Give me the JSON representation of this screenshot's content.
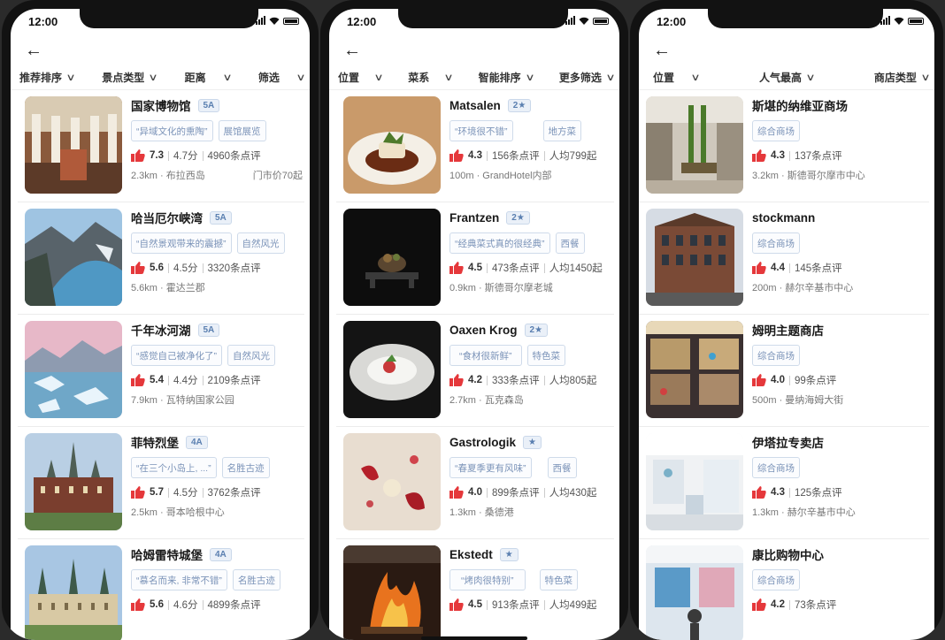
{
  "phones": [
    {
      "time": "12:00",
      "filters": [
        "推荐排序",
        "景点类型",
        "距离",
        "筛选"
      ],
      "items": [
        {
          "title": "国家博物馆",
          "badge": "5A",
          "tags": [
            "“异域文化的熏陶”",
            "展馆展览"
          ],
          "score": "7.3",
          "rating": "4.7分",
          "reviews": "4960条点评",
          "distance": "2.3km · 布拉西岛",
          "extra": "门市价70起"
        },
        {
          "title": "哈当厄尔峡湾",
          "badge": "5A",
          "tags": [
            "“自然景观带来的震撼”",
            "自然风光"
          ],
          "score": "5.6",
          "rating": "4.5分",
          "reviews": "3320条点评",
          "distance": "5.6km · 霍达兰郡",
          "extra": ""
        },
        {
          "title": "千年冰河湖",
          "badge": "5A",
          "tags": [
            "“感觉自己被净化了”",
            "自然风光"
          ],
          "score": "5.4",
          "rating": "4.4分",
          "reviews": "2109条点评",
          "distance": "7.9km · 瓦特纳国家公园",
          "extra": ""
        },
        {
          "title": "菲特烈堡",
          "badge": "4A",
          "tags": [
            "“在三个小岛上, ...”",
            "名胜古迹"
          ],
          "score": "5.7",
          "rating": "4.5分",
          "reviews": "3762条点评",
          "distance": "2.5km · 哥本哈根中心",
          "extra": ""
        },
        {
          "title": "哈姆雷特城堡",
          "badge": "4A",
          "tags": [
            "“慕名而来, 非常不错”",
            "名胜古迹"
          ],
          "score": "5.6",
          "rating": "4.6分",
          "reviews": "4899条点评",
          "distance": "",
          "extra": ""
        }
      ]
    },
    {
      "time": "12:00",
      "filters": [
        "位置",
        "菜系",
        "智能排序",
        "更多筛选"
      ],
      "items": [
        {
          "title": "Matsalen",
          "badge": "2★",
          "tags": [
            "“环境很不错”",
            "地方菜"
          ],
          "score": "4.3",
          "rating": "156条点评",
          "reviews": "人均799起",
          "distance": "100m · GrandHotel内部",
          "extra": ""
        },
        {
          "title": "Frantzen",
          "badge": "2★",
          "tags": [
            "“经典菜式真的很经典”",
            "西餐"
          ],
          "score": "4.5",
          "rating": "473条点评",
          "reviews": "人均1450起",
          "distance": "0.9km · 斯德哥尔摩老城",
          "extra": ""
        },
        {
          "title": "Oaxen Krog",
          "badge": "2★",
          "tags": [
            "“食材很新鲜”",
            "特色菜"
          ],
          "score": "4.2",
          "rating": "333条点评",
          "reviews": "人均805起",
          "distance": "2.7km · 瓦克森岛",
          "extra": ""
        },
        {
          "title": "Gastrologik",
          "badge": "★",
          "tags": [
            "“春夏季更有风味”",
            "西餐"
          ],
          "score": "4.0",
          "rating": "899条点评",
          "reviews": "人均430起",
          "distance": "1.3km · 桑德港",
          "extra": ""
        },
        {
          "title": "Ekstedt",
          "badge": "★",
          "tags": [
            "“烤肉很特别”",
            "特色菜"
          ],
          "score": "4.5",
          "rating": "913条点评",
          "reviews": "人均499起",
          "distance": "",
          "extra": ""
        }
      ]
    },
    {
      "time": "12:00",
      "filters": [
        "位置",
        "人气最高",
        "商店类型"
      ],
      "items": [
        {
          "title": "斯堪的纳维亚商场",
          "badge": "",
          "tags": [
            "综合商场"
          ],
          "score": "4.3",
          "rating": "137条点评",
          "reviews": "",
          "distance": "3.2km · 斯德哥尔摩市中心",
          "extra": ""
        },
        {
          "title": "stockmann",
          "badge": "",
          "tags": [
            "综合商场"
          ],
          "score": "4.4",
          "rating": "145条点评",
          "reviews": "",
          "distance": "200m · 赫尔辛基市中心",
          "extra": ""
        },
        {
          "title": "姆明主题商店",
          "badge": "",
          "tags": [
            "综合商场"
          ],
          "score": "4.0",
          "rating": "99条点评",
          "reviews": "",
          "distance": "500m · 曼纳海姆大街",
          "extra": ""
        },
        {
          "title": "伊塔拉专卖店",
          "badge": "",
          "tags": [
            "综合商场"
          ],
          "score": "4.3",
          "rating": "125条点评",
          "reviews": "",
          "distance": "1.3km · 赫尔辛基市中心",
          "extra": ""
        },
        {
          "title": "康比购物中心",
          "badge": "",
          "tags": [
            "综合商场"
          ],
          "score": "4.2",
          "rating": "73条点评",
          "reviews": "",
          "distance": "",
          "extra": ""
        }
      ]
    }
  ],
  "colors": {
    "thumbs_up": "#e5383b",
    "tag_text": "#7b93b8",
    "badge_text": "#5a7fb0"
  },
  "icons": {
    "back": "←",
    "chevron": "∨",
    "thumbs_up": "thumbs-up-icon"
  }
}
